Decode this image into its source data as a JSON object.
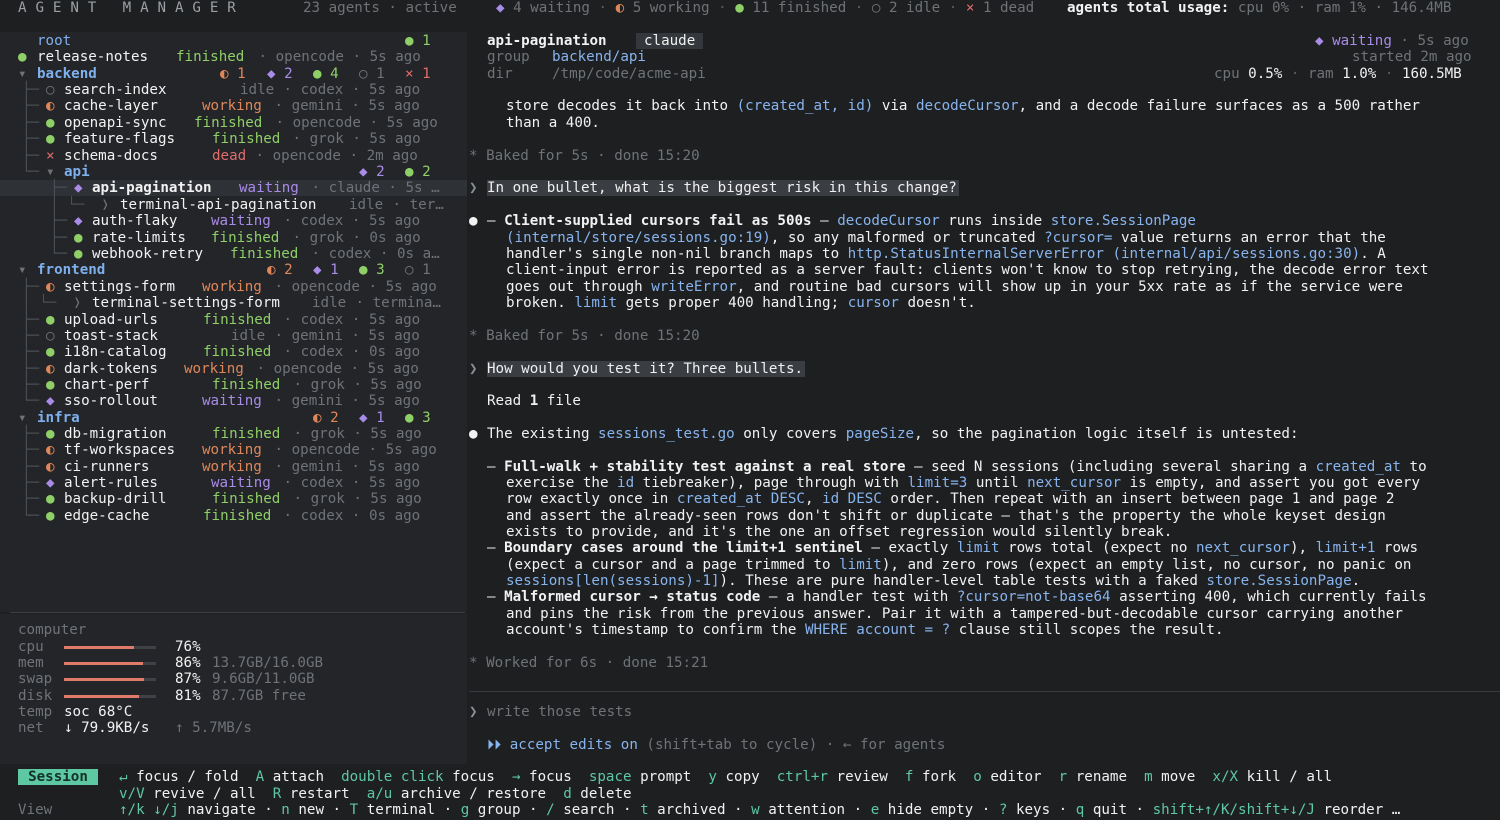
{
  "topbar": {
    "brand": "AGENT MANAGER",
    "agents_count": "23 agents · active",
    "waiting_icon": "◆",
    "waiting": "4 waiting",
    "working_icon": "◐",
    "working": "5 working",
    "finished_icon": "●",
    "finished": "11 finished",
    "idle_icon": "○",
    "idle": "2 idle",
    "dead_icon": "×",
    "dead": "1 dead",
    "usage_label": "agents total usage:",
    "usage_value": "cpu 0% · ram 1% · 146.4MB"
  },
  "sidebar": {
    "root_label": "root",
    "root_count": "● 1",
    "items": [
      {
        "indent": "",
        "icon": "●",
        "status_class": "green",
        "name": "release-notes",
        "status": "finished",
        "meta": " · opencode · 5s ago"
      },
      {
        "indent": "▾ ",
        "icon": "",
        "status_class": "group",
        "name": "backend",
        "status": "",
        "meta": ""
      },
      {
        "indent": "├─",
        "icon": "○",
        "status_class": "dim",
        "name": "search-index",
        "status": "idle",
        "meta": " · codex · 5s ago"
      },
      {
        "indent": "├─",
        "icon": "◐",
        "status_class": "orange",
        "name": "cache-layer",
        "status": "working",
        "meta": " · gemini · 5s ago"
      },
      {
        "indent": "├─",
        "icon": "●",
        "status_class": "green",
        "name": "openapi-sync",
        "status": "finished",
        "meta": " · opencode · 5s ago"
      },
      {
        "indent": "├─",
        "icon": "●",
        "status_class": "green",
        "name": "feature-flags",
        "status": "finished",
        "meta": " · grok · 5s ago"
      },
      {
        "indent": "├─",
        "icon": "×",
        "status_class": "red",
        "name": "schema-docs",
        "status": "dead",
        "meta": " · opencode · 2m ago"
      }
    ],
    "backend": {
      "label": "backend",
      "counts": [
        "◐ 1",
        "◆ 2",
        "● 4",
        "○ 1",
        "× 1"
      ]
    },
    "api": {
      "label": "api",
      "counts": [
        "◆ 2",
        "● 2"
      ]
    },
    "api_items": [
      {
        "icon": "◆",
        "name": "api-pagination",
        "status": "waiting",
        "meta": " · claude · 5s …",
        "cls": "purple",
        "selected": true
      },
      {
        "icon": "❭",
        "name": "terminal-api-pagination",
        "status": "idle",
        "meta": " · ter…",
        "cls": "dim"
      },
      {
        "icon": "◆",
        "name": "auth-flaky",
        "status": "waiting",
        "meta": " · codex · 5s ago",
        "cls": "purple"
      },
      {
        "icon": "●",
        "name": "rate-limits",
        "status": "finished",
        "meta": " · grok · 0s ago",
        "cls": "green"
      },
      {
        "icon": "●",
        "name": "webhook-retry",
        "status": "finished",
        "meta": " · codex · 0s a…",
        "cls": "green"
      }
    ],
    "frontend": {
      "label": "frontend",
      "counts": [
        "◐ 2",
        "◆ 1",
        "● 3",
        "○ 1"
      ]
    },
    "frontend_items": [
      {
        "icon": "◐",
        "name": "settings-form",
        "status": "working",
        "meta": " · opencode · 5s ago",
        "cls": "orange"
      },
      {
        "icon": "❭",
        "name": "terminal-settings-form",
        "status": "idle",
        "meta": " · termina…",
        "cls": "dim",
        "sub": true
      },
      {
        "icon": "●",
        "name": "upload-urls",
        "status": "finished",
        "meta": " · codex · 5s ago",
        "cls": "green"
      },
      {
        "icon": "○",
        "name": "toast-stack",
        "status": "idle",
        "meta": " · gemini · 5s ago",
        "cls": "dim"
      },
      {
        "icon": "●",
        "name": "i18n-catalog",
        "status": "finished",
        "meta": " · codex · 0s ago",
        "cls": "green"
      },
      {
        "icon": "◐",
        "name": "dark-tokens",
        "status": "working",
        "meta": " · opencode · 5s ago",
        "cls": "orange"
      },
      {
        "icon": "●",
        "name": "chart-perf",
        "status": "finished",
        "meta": " · grok · 5s ago",
        "cls": "green"
      },
      {
        "icon": "◆",
        "name": "sso-rollout",
        "status": "waiting",
        "meta": " · gemini · 5s ago",
        "cls": "purple"
      }
    ],
    "infra": {
      "label": "infra",
      "counts": [
        "◐ 2",
        "◆ 1",
        "● 3"
      ]
    },
    "infra_items": [
      {
        "icon": "●",
        "name": "db-migration",
        "status": "finished",
        "meta": " · grok · 5s ago",
        "cls": "green"
      },
      {
        "icon": "◐",
        "name": "tf-workspaces",
        "status": "working",
        "meta": " · opencode · 5s ago",
        "cls": "orange"
      },
      {
        "icon": "◐",
        "name": "ci-runners",
        "status": "working",
        "meta": " · gemini · 5s ago",
        "cls": "orange"
      },
      {
        "icon": "◆",
        "name": "alert-rules",
        "status": "waiting",
        "meta": " · codex · 5s ago",
        "cls": "purple"
      },
      {
        "icon": "●",
        "name": "backup-drill",
        "status": "finished",
        "meta": " · grok · 5s ago",
        "cls": "green"
      },
      {
        "icon": "●",
        "name": "edge-cache",
        "status": "finished",
        "meta": " · codex · 0s ago",
        "cls": "green"
      }
    ]
  },
  "computer": {
    "title": "computer",
    "cpu": {
      "label": "cpu",
      "value": "76%",
      "fraction": 0.76
    },
    "mem": {
      "label": "mem",
      "value": "86%",
      "fraction": 0.86,
      "detail": "13.7GB/16.0GB"
    },
    "swap": {
      "label": "swap",
      "value": "87%",
      "fraction": 0.87,
      "detail": "9.6GB/11.0GB"
    },
    "disk": {
      "label": "disk",
      "value": "81%",
      "fraction": 0.81,
      "detail": "87.7GB free"
    },
    "temp": {
      "label": "temp",
      "value": "soc 68°C"
    },
    "net": {
      "label": "net",
      "down": "↓ 79.9KB/s",
      "up": "↑ 5.7MB/s"
    }
  },
  "session": {
    "name": "api-pagination",
    "agent": "claude",
    "group_label": "group",
    "group": "backend/api",
    "dir_label": "dir",
    "dir": "/tmp/code/acme-api",
    "status_icon": "◆",
    "status": "waiting",
    "status_age": " · 5s ago",
    "started": "started 2m ago",
    "cpu_label": "cpu",
    "cpu": "0.5%",
    "ram_label": "ram",
    "ram": "1.0%",
    "mem": "160.5MB"
  },
  "transcript": {
    "line1a": "store decodes it back into ",
    "line1b": "(created_at, id)",
    "line1c": " via ",
    "line1d": "decodeCursor",
    "line1e": ", and a decode failure surfaces as a 500 rather",
    "line2": "than a 400.",
    "baked1": "* Baked for 5s · done 15:20",
    "q1": "In one bullet, what is the biggest risk in this change?",
    "a1_title": "Client-supplied cursors fail as 500s",
    "baked2": "* Baked for 5s · done 15:20",
    "q2": "How would you test it? Three bullets.",
    "read_file": "Read 1 file",
    "intro": "The existing sessions_test.go only covers pageSize, so the pagination logic itself is untested:",
    "b1_title": "Full-walk + stability test against a real store",
    "b2_title": "Boundary cases around the limit+1 sentinel",
    "b3_title": "Malformed cursor → status code",
    "worked": "* Worked for 6s · done 15:21"
  },
  "prompt": {
    "caret": "❯",
    "placeholder": "write those tests",
    "mode_prefix": "⏵⏵",
    "mode": "accept edits on",
    "mode_hint": " (shift+tab to cycle) · ← for agents"
  },
  "footer": {
    "session_label": "Session",
    "view_label": "View"
  },
  "colors": {
    "accent": "#5ec8a2",
    "finished": "#8fcf68",
    "working": "#e0875a",
    "waiting": "#a98be8",
    "dead": "#e06c6c",
    "link": "#88b4ee"
  }
}
